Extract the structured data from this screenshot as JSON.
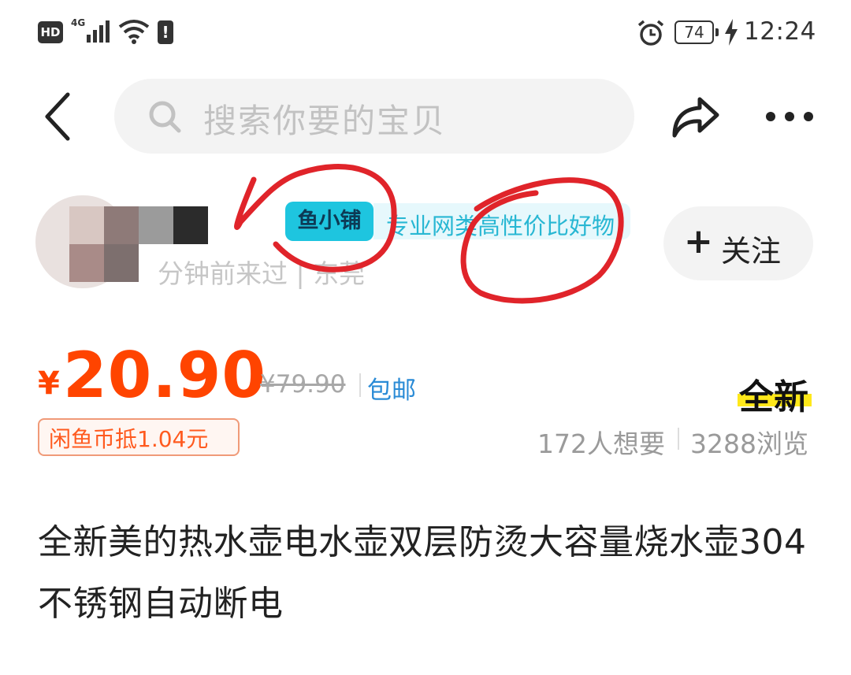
{
  "status_bar": {
    "hd": "HD",
    "network": "4G",
    "battery": "74",
    "time": "12:24",
    "icons": [
      "signal-icon",
      "wifi-icon",
      "alert-icon",
      "alarm-icon",
      "battery-icon",
      "charging-icon"
    ]
  },
  "top_bar": {
    "search_placeholder": "搜索你要的宝贝",
    "icons": [
      "back-icon",
      "search-icon",
      "share-icon",
      "more-icon"
    ]
  },
  "seller": {
    "shop_badge": "鱼小铺",
    "shop_slogan": "专业网类高性价比好物",
    "visit_info": "分钟前来过 | 东莞",
    "follow_label": "关注"
  },
  "price": {
    "currency": "¥",
    "current": "20.90",
    "original": "¥79.90",
    "shipping": "包邮",
    "coin_discount": "闲鱼币抵1.04元"
  },
  "condition": "全新",
  "stats": {
    "want": "172人想要",
    "views": "3288浏览"
  },
  "item_title": "全新美的热水壶电水壶双层防烫大容量烧水壶304不锈钢自动断电",
  "colors": {
    "price": "#ff4400",
    "shop_badge": "#1ec5df",
    "shipping": "#2a8bd6",
    "highlight": "#ffe81a",
    "annotation": "#e0242a"
  }
}
